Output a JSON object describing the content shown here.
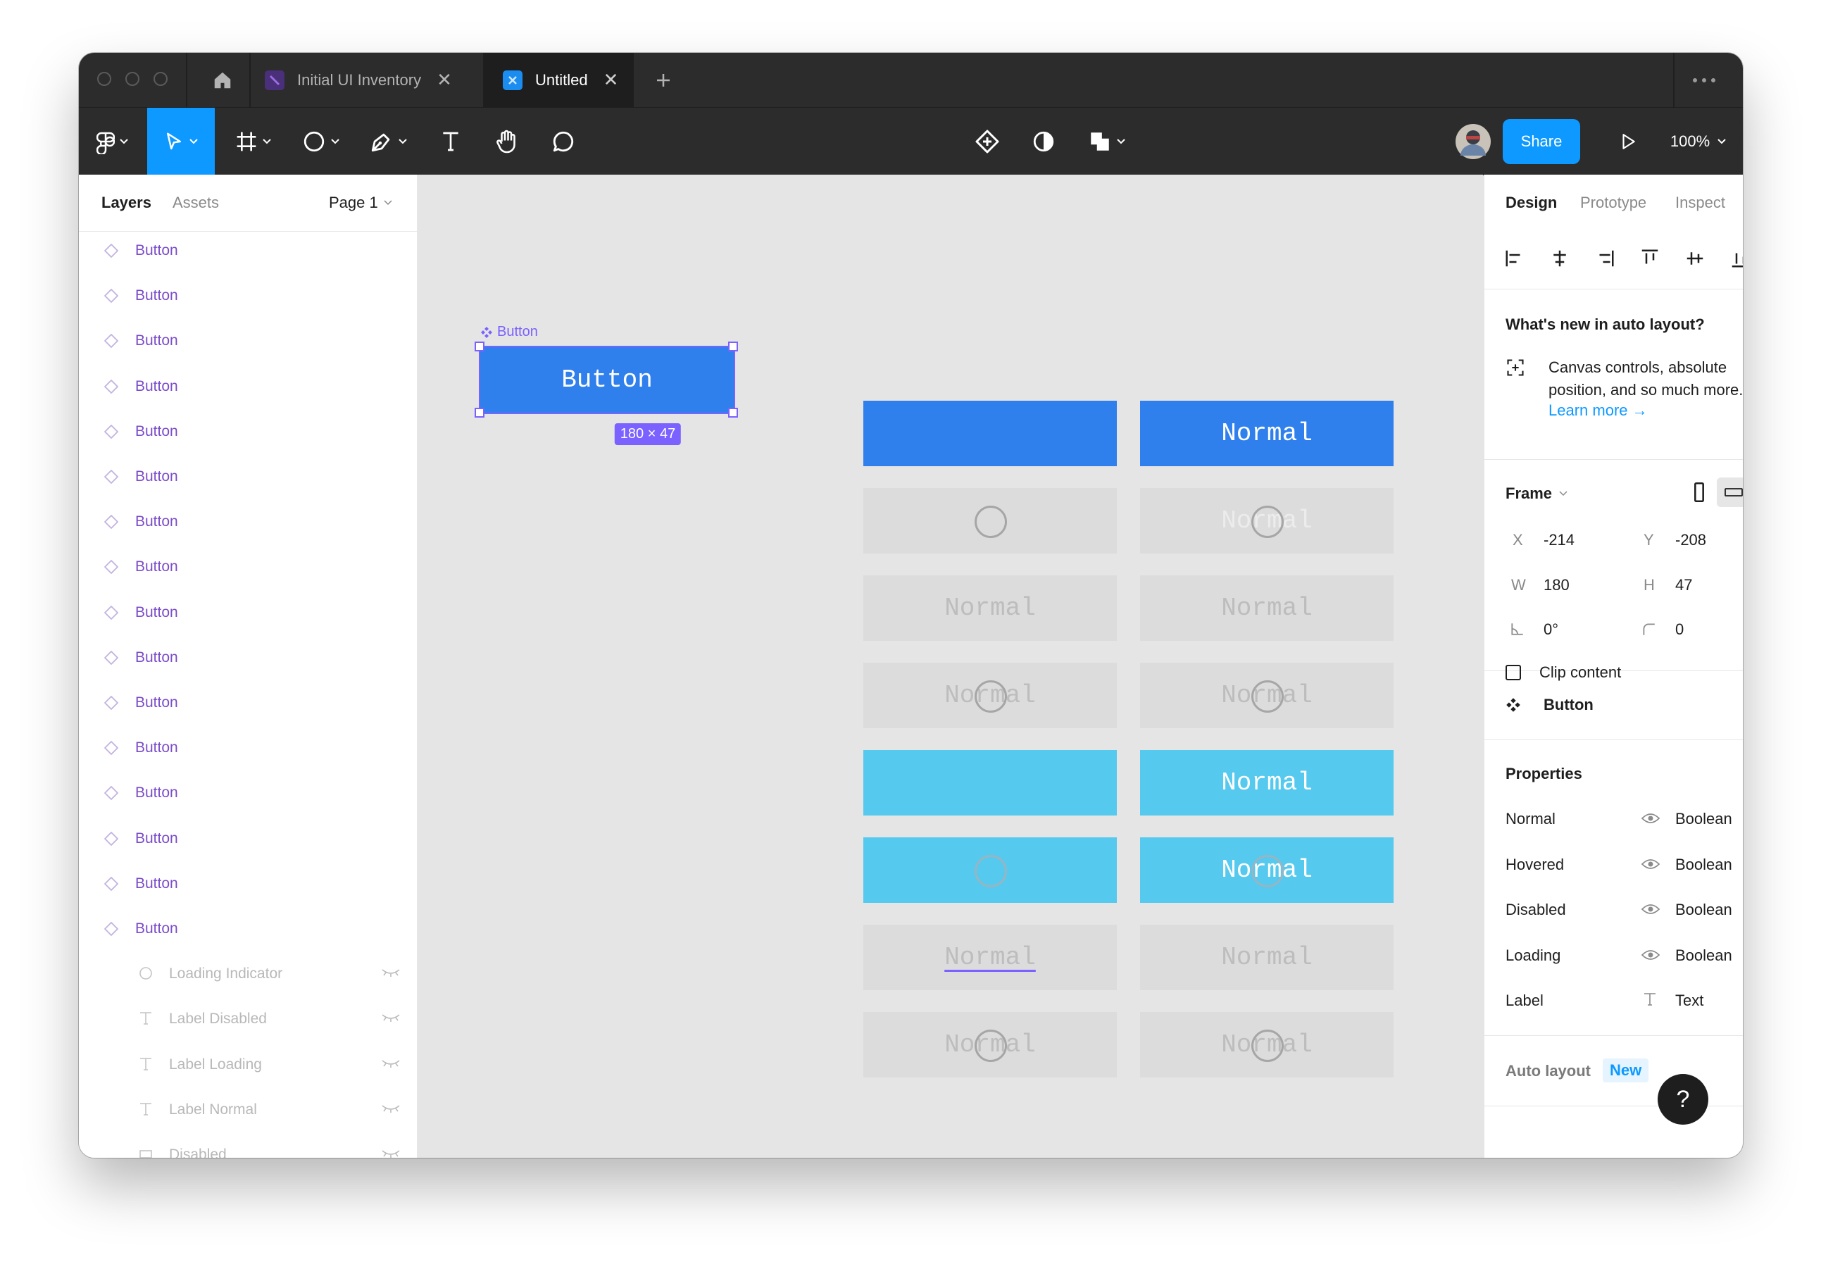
{
  "window": {
    "tabs": [
      {
        "label": "Initial UI Inventory",
        "icon": "file-icon"
      },
      {
        "label": "Untitled",
        "icon": "file-icon"
      }
    ],
    "zoom": "100%",
    "share_label": "Share",
    "colors": {
      "accent": "#0d99ff",
      "dark": "#2c2c2c",
      "layer_purple": "#7b4cc8"
    }
  },
  "layers_panel": {
    "tabs": [
      "Layers",
      "Assets"
    ],
    "page": "Page 1",
    "layers": [
      "Button",
      "Button",
      "Button",
      "Button",
      "Button",
      "Button",
      "Button",
      "Button",
      "Button",
      "Button",
      "Button",
      "Button",
      "Button",
      "Button",
      "Button",
      "Button"
    ],
    "children": [
      {
        "label": "Loading Indicator",
        "icon": "ellipse-icon"
      },
      {
        "label": "Label Disabled",
        "icon": "text-icon"
      },
      {
        "label": "Label Loading",
        "icon": "text-icon"
      },
      {
        "label": "Label Normal",
        "icon": "text-icon"
      },
      {
        "label": "Disabled",
        "icon": "rectangle-icon"
      }
    ]
  },
  "canvas": {
    "selected": {
      "name": "Button",
      "label": "Button",
      "size_badge": "180 × 47"
    },
    "variant_label": "Normal"
  },
  "design_panel": {
    "tabs": [
      "Design",
      "Prototype",
      "Inspect"
    ],
    "whats_new": {
      "title": "What's new in auto layout?",
      "body": "Canvas controls, absolute position, and so much more.",
      "link": "Learn more →"
    },
    "frame": {
      "label": "Frame",
      "x_label": "X",
      "x": "-214",
      "y_label": "Y",
      "y": "-208",
      "w_label": "W",
      "w": "180",
      "h_label": "H",
      "h": "47",
      "rotation": "0°",
      "radius": "0",
      "clip_label": "Clip content"
    },
    "component": {
      "name": "Button"
    },
    "properties": {
      "title": "Properties",
      "rows": [
        {
          "name": "Normal",
          "type": "Boolean"
        },
        {
          "name": "Hovered",
          "type": "Boolean"
        },
        {
          "name": "Disabled",
          "type": "Boolean"
        },
        {
          "name": "Loading",
          "type": "Boolean"
        },
        {
          "name": "Label",
          "type": "Text"
        }
      ]
    },
    "auto_layout": {
      "label": "Auto layout",
      "badge": "New"
    },
    "help": "?"
  }
}
